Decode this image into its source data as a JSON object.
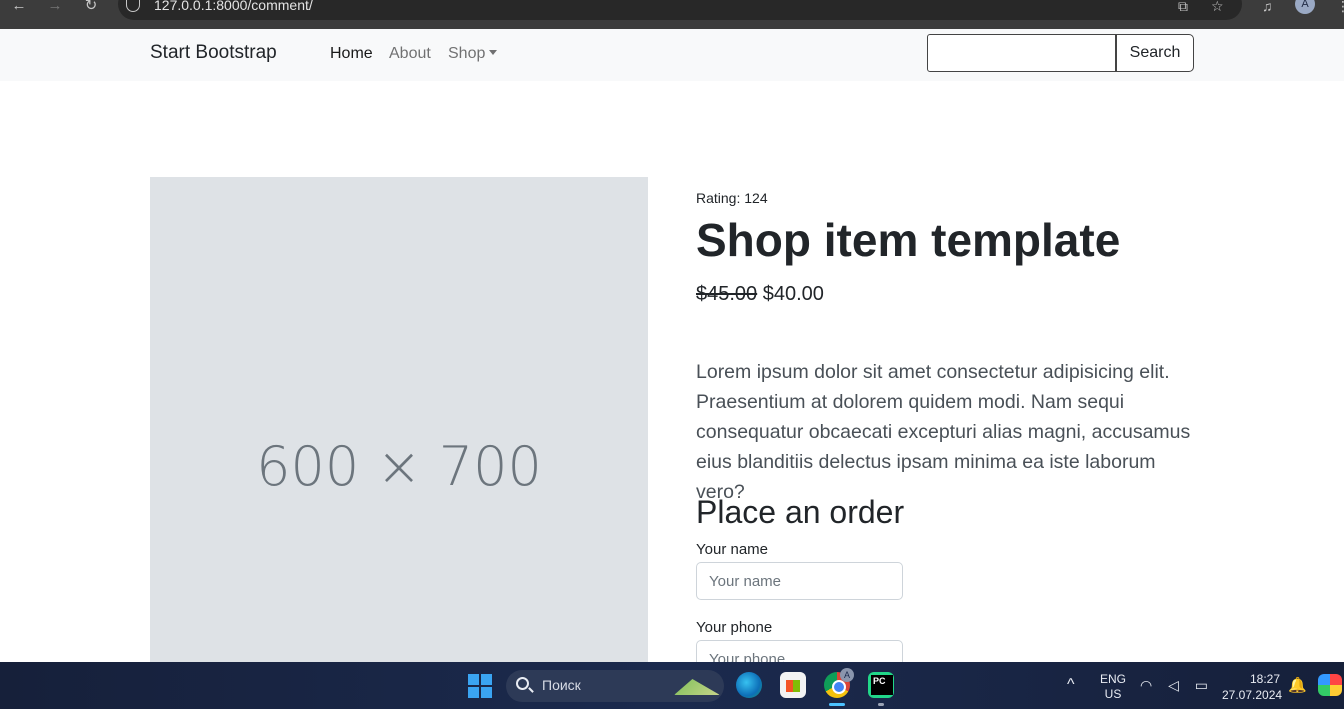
{
  "browser": {
    "url": "127.0.0.1:8000/comment/",
    "back_glyph": "←",
    "forward_glyph": "→",
    "reload_glyph": "↻",
    "translate_glyph": "⧉",
    "bookmark_glyph": "☆",
    "media_glyph": "♫",
    "profile_initial": "A",
    "menu_glyph": "⋮"
  },
  "navbar": {
    "brand": "Start Bootstrap",
    "links": [
      {
        "label": "Home",
        "active": true
      },
      {
        "label": "About",
        "active": false
      },
      {
        "label": "Shop",
        "active": false,
        "dropdown": true
      }
    ],
    "search": {
      "value": "",
      "placeholder": "",
      "button": "Search"
    }
  },
  "product": {
    "image_placeholder": "600 × 700",
    "rating": "Rating: 124",
    "title": "Shop item template",
    "old_price": "$45.00",
    "price": "$40.00",
    "description": "Lorem ipsum dolor sit amet consectetur adipisicing elit. Praesentium at dolorem quidem modi. Nam sequi consequatur obcaecati excepturi alias magni, accusamus eius blanditiis delectus ipsam minima ea iste laborum vero?"
  },
  "order": {
    "title": "Place an order",
    "name_label": "Your name",
    "name_placeholder": "Your name",
    "phone_label": "Your phone",
    "phone_placeholder": "Your phone"
  },
  "taskbar": {
    "search_text": "Поиск",
    "chrome_badge": "A",
    "chevron": "^",
    "lang_line1": "ENG",
    "lang_line2": "US",
    "tray_icons": "◠ ◁ ▭",
    "time": "18:27",
    "date": "27.07.2024",
    "bell_glyph": "🔔",
    "colors": {
      "accent": "#4cc2ff",
      "taskbar": "#1b2a4e"
    }
  }
}
